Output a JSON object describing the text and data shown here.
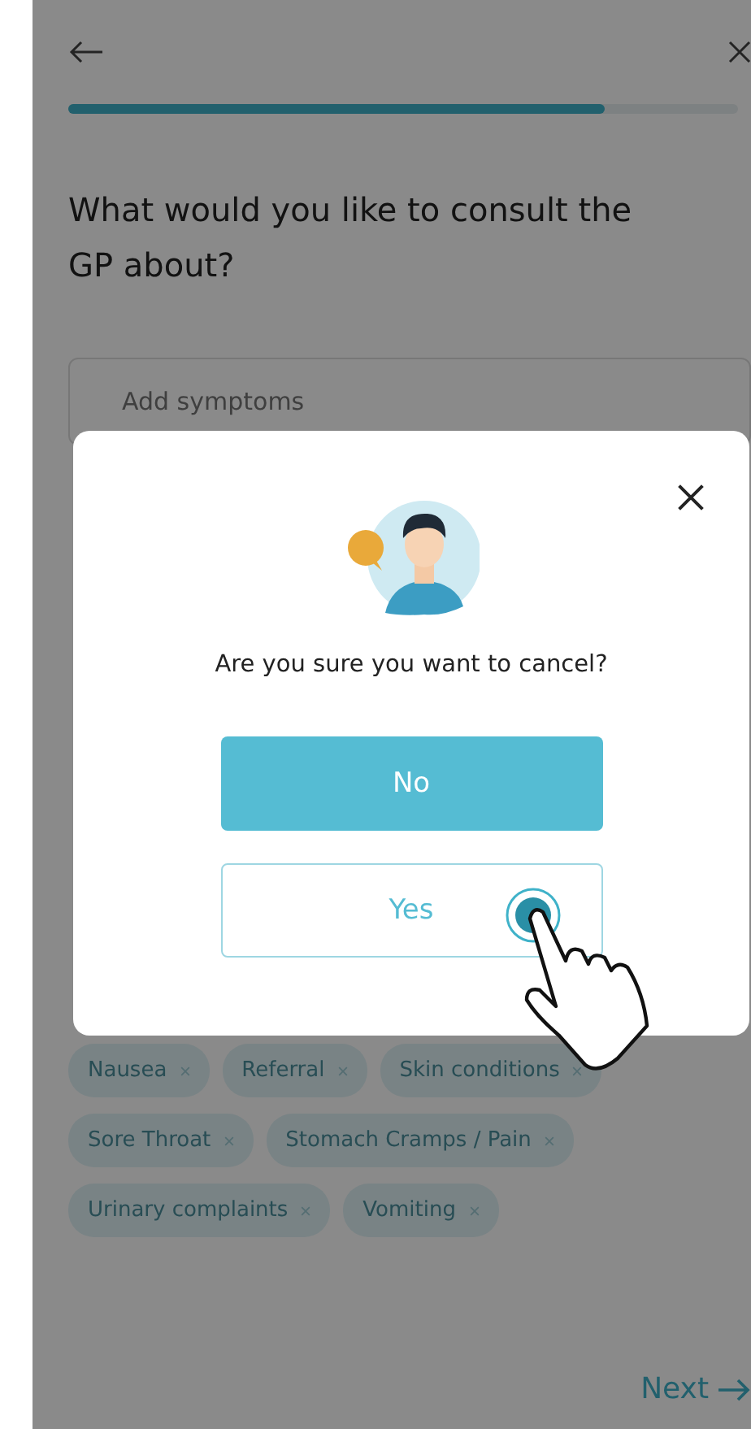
{
  "progress": {
    "level": 0.8
  },
  "question": "What would you like to consult the GP about?",
  "symptom_field": {
    "placeholder": "Add symptoms"
  },
  "symptom_chips": [
    {
      "label": "Nausea"
    },
    {
      "label": "Referral"
    },
    {
      "label": "Skin conditions"
    },
    {
      "label": "Sore Throat"
    },
    {
      "label": "Stomach Cramps / Pain"
    },
    {
      "label": "Urinary complaints"
    },
    {
      "label": "Vomiting"
    }
  ],
  "next_button": {
    "label": "Next"
  },
  "dialog": {
    "message": "Are you sure you want to cancel?",
    "buttons": [
      {
        "label": "No",
        "kind": "primary"
      },
      {
        "label": "Yes",
        "kind": "secondary"
      }
    ]
  }
}
